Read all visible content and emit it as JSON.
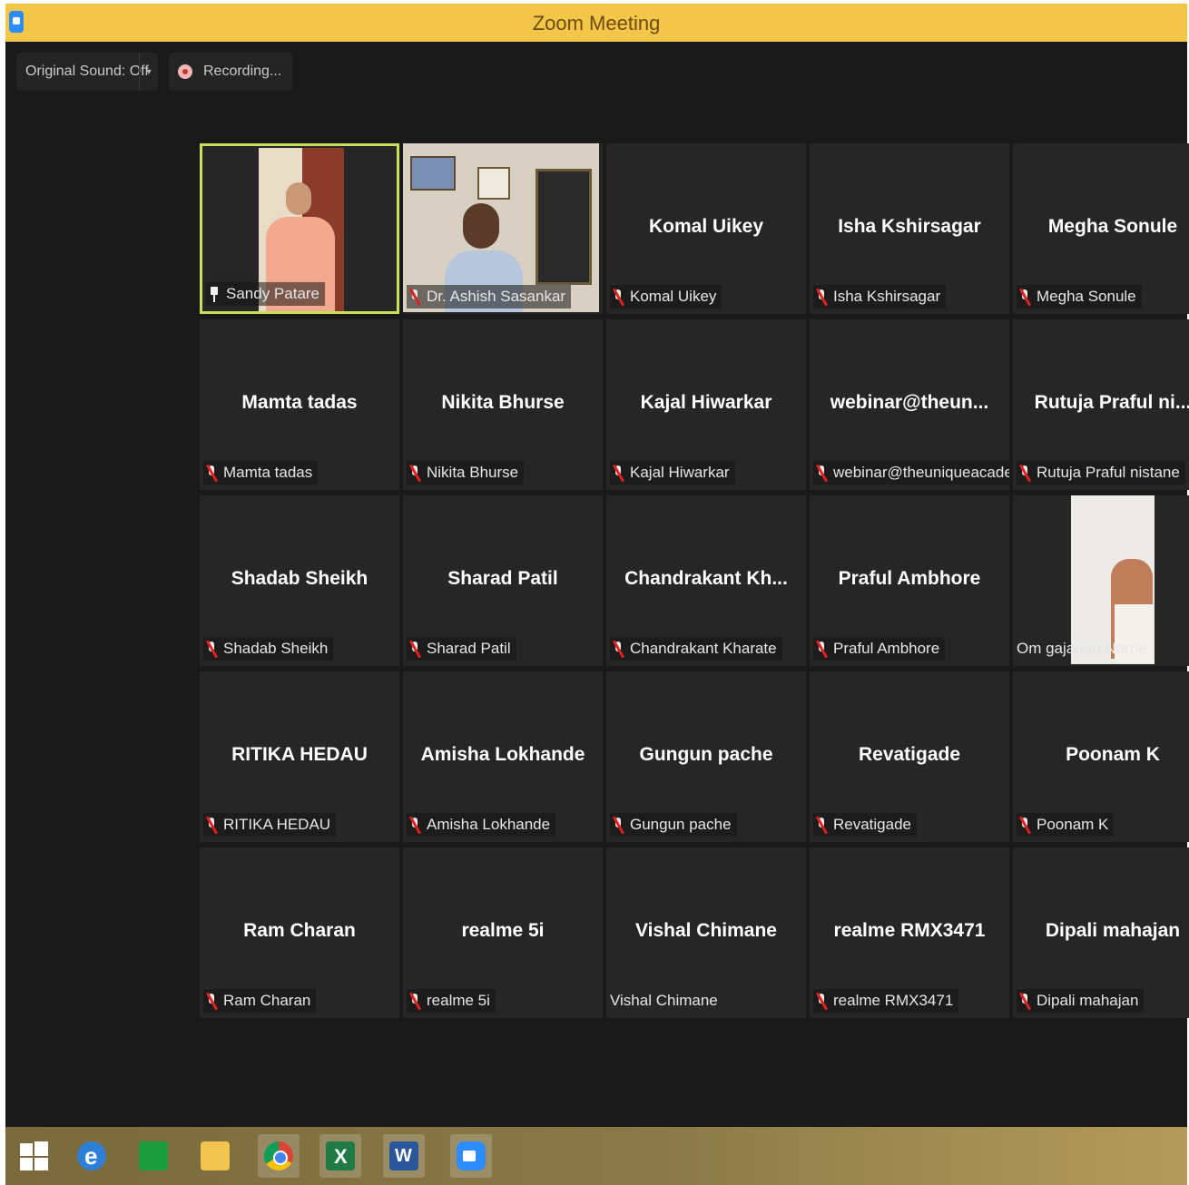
{
  "window": {
    "title": "Zoom Meeting",
    "icon": "zoom-app-icon"
  },
  "toolbar": {
    "original_sound_label": "Original Sound: Off",
    "original_sound_dropdown": "▾",
    "recording_label": "Recording..."
  },
  "gallery": {
    "tiles": [
      {
        "display": "",
        "label": "Sandy Patare",
        "icon": "pin-icon",
        "video": true,
        "active": true
      },
      {
        "display": "",
        "label": "Dr. Ashish Sasankar",
        "icon": "mic-muted-icon",
        "video": true
      },
      {
        "display": "Komal Uikey",
        "label": "Komal Uikey",
        "icon": "mic-muted-icon"
      },
      {
        "display": "Isha Kshirsagar",
        "label": "Isha Kshirsagar",
        "icon": "mic-muted-icon"
      },
      {
        "display": "Megha Sonule",
        "label": "Megha Sonule",
        "icon": "mic-muted-icon"
      },
      {
        "display": "Mamta tadas",
        "label": "Mamta tadas",
        "icon": "mic-muted-icon"
      },
      {
        "display": "Nikita Bhurse",
        "label": "Nikita Bhurse",
        "icon": "mic-muted-icon"
      },
      {
        "display": "Kajal Hiwarkar",
        "label": "Kajal Hiwarkar",
        "icon": "mic-muted-icon"
      },
      {
        "display": "webinar@theun...",
        "label": "webinar@theuniqueacade...",
        "icon": "mic-muted-icon"
      },
      {
        "display": "Rutuja Praful ni...",
        "label": "Rutuja Praful nistane",
        "icon": "mic-muted-icon"
      },
      {
        "display": "Shadab Sheikh",
        "label": "Shadab Sheikh",
        "icon": "mic-muted-icon"
      },
      {
        "display": "Sharad Patil",
        "label": "Sharad Patil",
        "icon": "mic-muted-icon"
      },
      {
        "display": "Chandrakant Kh...",
        "label": "Chandrakant Kharate",
        "icon": "mic-muted-icon"
      },
      {
        "display": "Praful Ambhore",
        "label": "Praful Ambhore",
        "icon": "mic-muted-icon"
      },
      {
        "display": "",
        "label": "Om gajanan Narne",
        "icon": "",
        "video": true
      },
      {
        "display": "RITIKA HEDAU",
        "label": "RITIKA HEDAU",
        "icon": "mic-muted-icon"
      },
      {
        "display": "Amisha Lokhande",
        "label": "Amisha Lokhande",
        "icon": "mic-muted-icon"
      },
      {
        "display": "Gungun pache",
        "label": "Gungun pache",
        "icon": "mic-muted-icon"
      },
      {
        "display": "Revatigade",
        "label": "Revatigade",
        "icon": "mic-muted-icon"
      },
      {
        "display": "Poonam K",
        "label": "Poonam K",
        "icon": "mic-muted-icon"
      },
      {
        "display": "Ram Charan",
        "label": "Ram Charan",
        "icon": "mic-muted-icon"
      },
      {
        "display": "realme 5i",
        "label": "realme 5i",
        "icon": "mic-muted-icon"
      },
      {
        "display": "Vishal Chimane",
        "label": "Vishal Chimane",
        "icon": ""
      },
      {
        "display": "realme RMX3471",
        "label": "realme RMX3471",
        "icon": "mic-muted-icon"
      },
      {
        "display": "Dipali mahajan",
        "label": "Dipali mahajan",
        "icon": "mic-muted-icon"
      }
    ]
  },
  "taskbar": {
    "items": [
      {
        "name": "start-button",
        "icon": "windows-start-icon"
      },
      {
        "name": "internet-explorer",
        "icon": "internet-explorer-icon"
      },
      {
        "name": "store",
        "icon": "store-icon"
      },
      {
        "name": "file-explorer",
        "icon": "folder-icon"
      },
      {
        "name": "chrome",
        "icon": "chrome-icon"
      },
      {
        "name": "excel",
        "icon": "excel-icon"
      },
      {
        "name": "word",
        "icon": "word-icon"
      },
      {
        "name": "zoom",
        "icon": "zoom-icon"
      }
    ]
  },
  "colors": {
    "titlebar": "#f3c64a",
    "meeting_bg": "#1a1a1a",
    "tile_bg": "#262626",
    "active_speaker_border": "#c9e05e",
    "muted_red": "#e02020"
  }
}
